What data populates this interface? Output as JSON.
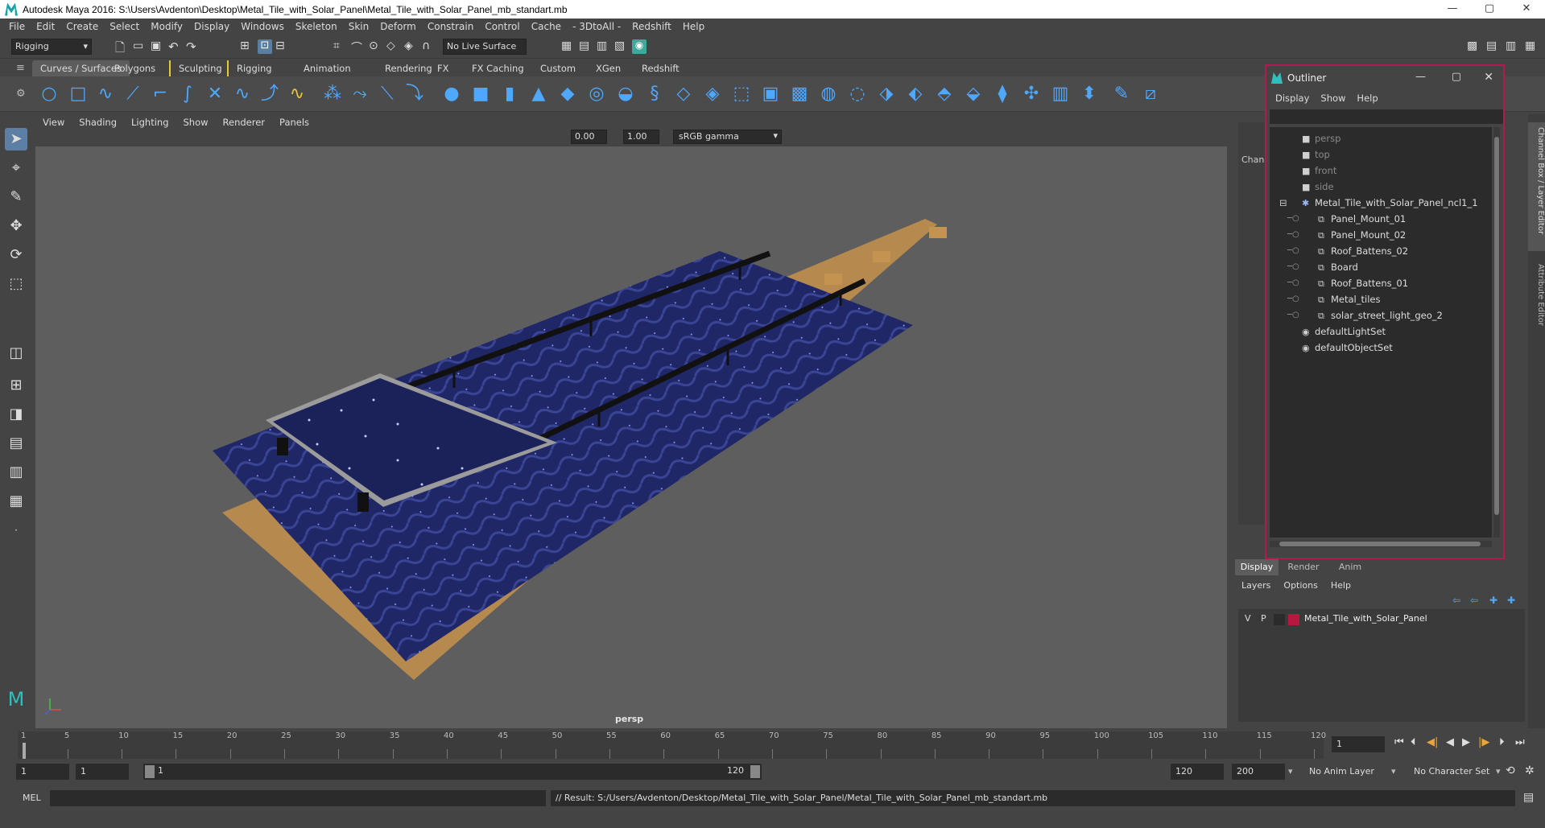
{
  "window": {
    "title": "Autodesk Maya 2016: S:\\Users\\Avdenton\\Desktop\\Metal_Tile_with_Solar_Panel\\Metal_Tile_with_Solar_Panel_mb_standart.mb",
    "minimize": "—",
    "maximize": "▢",
    "close": "✕"
  },
  "menubar": [
    "File",
    "Edit",
    "Create",
    "Select",
    "Modify",
    "Display",
    "Windows",
    "Skeleton",
    "Skin",
    "Deform",
    "Constrain",
    "Control",
    "Cache",
    "- 3DtoAll -",
    "Redshift",
    "Help"
  ],
  "statusline": {
    "menu_set": "Rigging",
    "live_surface": "No Live Surface"
  },
  "shelf": {
    "tabs": [
      "Curves / Surfaces",
      "Polygons",
      "Sculpting",
      "Rigging",
      "Animation",
      "Rendering",
      "FX",
      "FX Caching",
      "Custom",
      "XGen",
      "Redshift"
    ],
    "active_tab": "Curves / Surfaces"
  },
  "viewport": {
    "menu": [
      "View",
      "Shading",
      "Lighting",
      "Show",
      "Renderer",
      "Panels"
    ],
    "exposure": "0.00",
    "gamma": "1.00",
    "color_space": "sRGB gamma",
    "camera_label": "persp"
  },
  "outliner": {
    "title": "Outliner",
    "menu": [
      "Display",
      "Show",
      "Help"
    ],
    "items": [
      {
        "label": "persp",
        "indent": 0,
        "dim": true,
        "icon": "camera-icon"
      },
      {
        "label": "top",
        "indent": 0,
        "dim": true,
        "icon": "camera-icon"
      },
      {
        "label": "front",
        "indent": 0,
        "dim": true,
        "icon": "camera-icon"
      },
      {
        "label": "side",
        "indent": 0,
        "dim": true,
        "icon": "camera-icon"
      },
      {
        "label": "Metal_Tile_with_Solar_Panel_ncl1_1",
        "indent": 0,
        "dim": false,
        "icon": "group-icon",
        "expanded": true
      },
      {
        "label": "Panel_Mount_01",
        "indent": 1,
        "dim": false,
        "icon": "mesh-icon"
      },
      {
        "label": "Panel_Mount_02",
        "indent": 1,
        "dim": false,
        "icon": "mesh-icon"
      },
      {
        "label": "Roof_Battens_02",
        "indent": 1,
        "dim": false,
        "icon": "mesh-icon"
      },
      {
        "label": "Board",
        "indent": 1,
        "dim": false,
        "icon": "mesh-icon"
      },
      {
        "label": "Roof_Battens_01",
        "indent": 1,
        "dim": false,
        "icon": "mesh-icon"
      },
      {
        "label": "Metal_tiles",
        "indent": 1,
        "dim": false,
        "icon": "mesh-icon"
      },
      {
        "label": "solar_street_light_geo_2",
        "indent": 1,
        "dim": false,
        "icon": "mesh-icon"
      },
      {
        "label": "defaultLightSet",
        "indent": 0,
        "dim": false,
        "icon": "set-icon"
      },
      {
        "label": "defaultObjectSet",
        "indent": 0,
        "dim": false,
        "icon": "set-icon"
      }
    ]
  },
  "channel_box": {
    "label": "Chann"
  },
  "side_tabs": [
    "Channel Box / Layer Editor",
    "Attribute Editor"
  ],
  "layer_editor": {
    "tabs": [
      "Display",
      "Render",
      "Anim"
    ],
    "menu": [
      "Layers",
      "Options",
      "Help"
    ],
    "layers": [
      {
        "v": "V",
        "p": "P",
        "name": "Metal_Tile_with_Solar_Panel",
        "color": "#b8173f"
      }
    ]
  },
  "timeline": {
    "ticks": [
      "1",
      "5",
      "10",
      "15",
      "20",
      "25",
      "30",
      "35",
      "40",
      "45",
      "50",
      "55",
      "60",
      "65",
      "70",
      "75",
      "80",
      "85",
      "90",
      "95",
      "100",
      "105",
      "110",
      "115",
      "120"
    ],
    "current_frame": "1"
  },
  "range": {
    "start": "1",
    "playback_start": "1",
    "slider_start": "1",
    "slider_end": "120",
    "playback_end": "120",
    "end": "200",
    "anim_layer": "No Anim Layer",
    "char_set": "No Character Set"
  },
  "cmdline": {
    "mode": "MEL",
    "result": "// Result: S:/Users/Avdenton/Desktop/Metal_Tile_with_Solar_Panel/Metal_Tile_with_Solar_Panel_mb_standart.mb"
  },
  "colors": {
    "accent": "#b21a52",
    "shelf_icon": "#4fa8ff",
    "tile_blue": "#1f2766",
    "wood": "#b68a4e"
  }
}
